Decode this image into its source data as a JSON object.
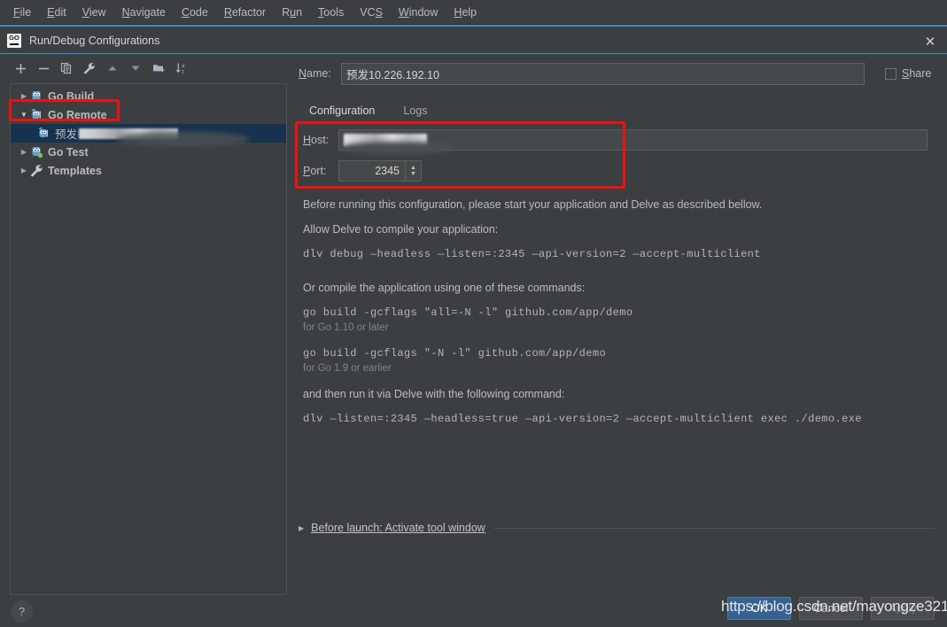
{
  "menubar": {
    "items": [
      {
        "pre": "",
        "mn": "F",
        "post": "ile"
      },
      {
        "pre": "",
        "mn": "E",
        "post": "dit"
      },
      {
        "pre": "",
        "mn": "V",
        "post": "iew"
      },
      {
        "pre": "",
        "mn": "N",
        "post": "avigate"
      },
      {
        "pre": "",
        "mn": "C",
        "post": "ode"
      },
      {
        "pre": "",
        "mn": "R",
        "post": "efactor"
      },
      {
        "pre": "R",
        "mn": "u",
        "post": "n"
      },
      {
        "pre": "",
        "mn": "T",
        "post": "ools"
      },
      {
        "pre": "VC",
        "mn": "S",
        "post": ""
      },
      {
        "pre": "",
        "mn": "W",
        "post": "indow"
      },
      {
        "pre": "",
        "mn": "H",
        "post": "elp"
      }
    ]
  },
  "titlebar": {
    "icon": "go-logo-icon",
    "title": "Run/Debug Configurations",
    "close": "✕"
  },
  "toolbar": {
    "buttons": [
      {
        "name": "add-configuration-button",
        "icon": "plus-icon"
      },
      {
        "name": "remove-configuration-button",
        "icon": "minus-icon"
      },
      {
        "name": "copy-configuration-button",
        "icon": "copy-icon"
      },
      {
        "name": "edit-templates-button",
        "icon": "wrench-icon"
      },
      {
        "name": "move-up-button",
        "icon": "arrow-up-icon"
      },
      {
        "name": "move-down-button",
        "icon": "arrow-down-icon"
      },
      {
        "name": "new-folder-button",
        "icon": "folder-add-icon"
      },
      {
        "name": "sort-configurations-button",
        "icon": "sort-az-icon"
      }
    ]
  },
  "tree": {
    "nodes": [
      {
        "label": "Go Build",
        "arrow": "▶",
        "expanded": false,
        "selected": false,
        "child": false,
        "icon": "go-build-icon"
      },
      {
        "label": "Go Remote",
        "arrow": "▼",
        "expanded": true,
        "selected": false,
        "child": false,
        "icon": "go-remote-icon",
        "highlighted": true
      },
      {
        "label": "预发",
        "arrow": "",
        "expanded": false,
        "selected": true,
        "child": true,
        "icon": "go-remote-icon",
        "redacted": true
      },
      {
        "label": "Go Test",
        "arrow": "▶",
        "expanded": false,
        "selected": false,
        "child": false,
        "icon": "go-test-icon"
      },
      {
        "label": "Templates",
        "arrow": "▶",
        "expanded": false,
        "selected": false,
        "child": false,
        "icon": "wrench-icon"
      }
    ]
  },
  "form": {
    "name_label": "Name:",
    "name_value": "预发10.226.192.10",
    "share_label": "Share",
    "share_checked": false,
    "tabs": [
      {
        "label": "Configuration",
        "active": true
      },
      {
        "label": "Logs",
        "active": false
      }
    ],
    "host_label": "Host:",
    "host_value": "",
    "port_label": "Port:",
    "port_value": "2345",
    "spinner_up": "▲",
    "spinner_down": "▼"
  },
  "info": {
    "intro": "Before running this configuration, please start your application and Delve as described bellow.",
    "section1_title": "Allow Delve to compile your application:",
    "section1_cmd": "dlv debug —headless —listen=:2345 —api-version=2 —accept-multiclient",
    "section2_title": "Or compile the application using one of these commands:",
    "section2_cmd1": "go build -gcflags \"all=-N -l\" github.com/app/demo",
    "section2_note1": "for Go 1.10 or later",
    "section2_cmd2": "go build -gcflags \"-N -l\" github.com/app/demo",
    "section2_note2": "for Go 1.9 or earlier",
    "section3_title": "and then run it via Delve with the following command:",
    "section3_cmd": "dlv —listen=:2345 —headless=true —api-version=2 —accept-multiclient exec ./demo.exe"
  },
  "before_launch": {
    "arrow": "▶",
    "text": "Before launch: Activate tool window"
  },
  "footer": {
    "help": "?",
    "buttons": [
      {
        "label": "OK",
        "style": "primary",
        "name": "ok-button"
      },
      {
        "label": "Cancel",
        "style": "normal",
        "name": "cancel-button"
      },
      {
        "label": "Apply",
        "style": "disabled",
        "name": "apply-button"
      }
    ],
    "watermark": "https://blog.csdn.net/mayongze321"
  },
  "colors": {
    "window_bg": "#3c3f41",
    "accent_blue": "#4a88c7",
    "selection_navy": "#16324e",
    "annotation_red": "#f01010",
    "text_primary": "#bbbbbb",
    "text_muted": "#808386",
    "input_bg": "#45494a"
  }
}
